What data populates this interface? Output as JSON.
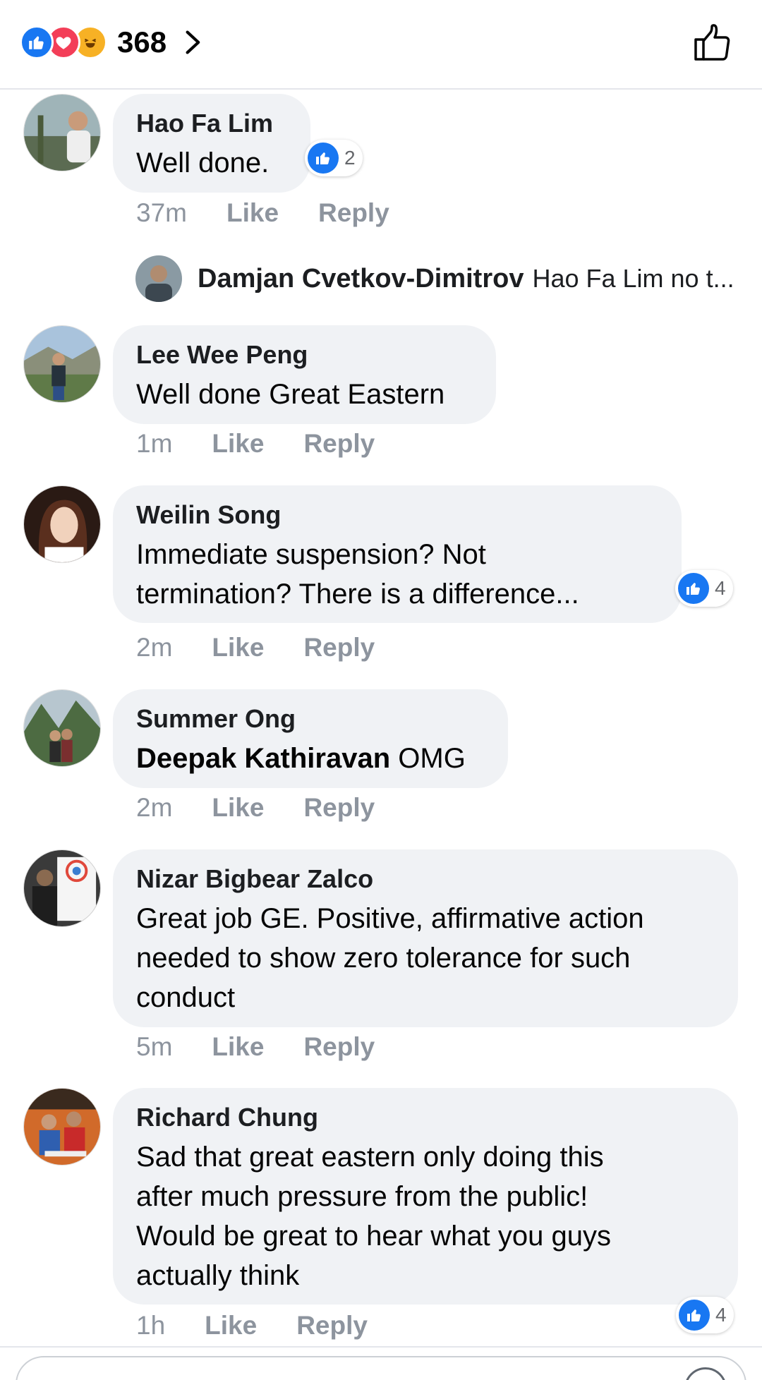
{
  "header": {
    "reaction_count": "368",
    "reactions": [
      "like-icon",
      "love-icon",
      "haha-icon"
    ]
  },
  "comments": [
    {
      "name": "Hao Fa Lim",
      "text": "Well done.",
      "time": "37m",
      "like": "Like",
      "reply": "Reply",
      "reaction_count": "2"
    },
    {
      "name": "Lee Wee Peng",
      "text": "Well done Great Eastern",
      "time": "1m",
      "like": "Like",
      "reply": "Reply"
    },
    {
      "name": "Weilin Song",
      "text_lines": [
        "Immediate suspension? Not",
        "termination? There is a difference..."
      ],
      "time": "2m",
      "like": "Like",
      "reply": "Reply",
      "reaction_count": "4"
    },
    {
      "name": "Summer Ong",
      "mention": "Deepak Kathiravan",
      "text": "OMG",
      "time": "2m",
      "like": "Like",
      "reply": "Reply"
    },
    {
      "name": "Nizar Bigbear Zalco",
      "text_lines": [
        "Great job GE. Positive, affirmative action",
        "needed to show zero tolerance for such",
        "conduct"
      ],
      "time": "5m",
      "like": "Like",
      "reply": "Reply"
    },
    {
      "name": "Richard Chung",
      "text_lines": [
        "Sad that great eastern only doing this",
        "after much pressure from the public!",
        "Would be great to hear what you guys",
        "actually think"
      ],
      "time": "1h",
      "like": "Like",
      "reply": "Reply",
      "reaction_count": "4"
    }
  ],
  "reply_preview": {
    "name": "Damjan Cvetkov-Dimitrov",
    "text": "Hao Fa Lim no t..."
  },
  "colors": {
    "accent": "#1877f2",
    "bubble": "#f0f2f5",
    "meta": "#8d949e"
  }
}
